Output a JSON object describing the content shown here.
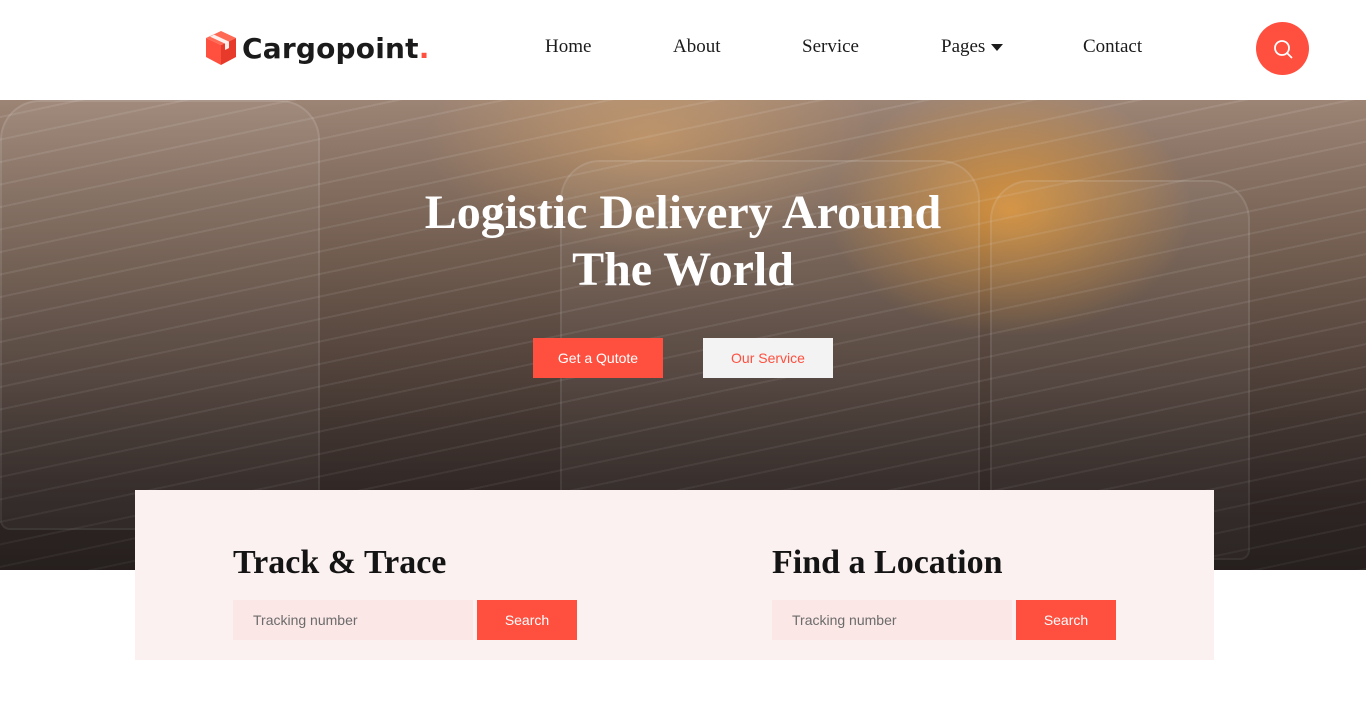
{
  "brand": {
    "name": "Cargopoint",
    "dot": ".",
    "accent": "#ff4f3f"
  },
  "nav": {
    "items": [
      {
        "label": "Home"
      },
      {
        "label": "About"
      },
      {
        "label": "Service"
      },
      {
        "label": "Pages"
      },
      {
        "label": "Contact"
      }
    ]
  },
  "icons": {
    "search": "search-icon",
    "logo": "box-icon",
    "pages_dropdown": "caret-down-icon"
  },
  "hero": {
    "title_line1": "Logistic Delivery Around",
    "title_line2": "The World",
    "primary_button": "Get a Qutote",
    "secondary_button": "Our Service"
  },
  "track": {
    "title": "Track & Trace",
    "placeholder": "Tracking number",
    "button": "Search"
  },
  "location": {
    "title": "Find a Location",
    "placeholder": "Tracking number",
    "button": "Search"
  }
}
